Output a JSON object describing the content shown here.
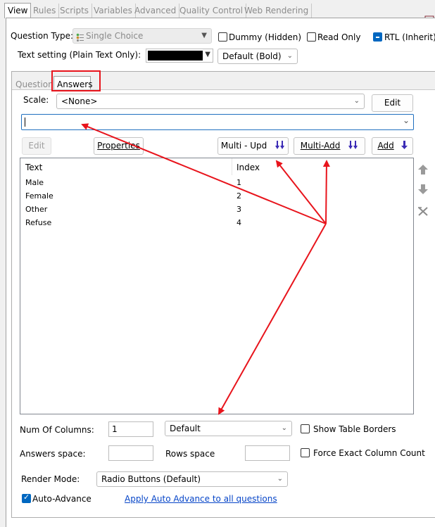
{
  "tabs": [
    "View",
    "Rules",
    "Scripts",
    "Variables",
    "Advanced",
    "Quality Control",
    "Web Rendering"
  ],
  "question_type": {
    "label": "Question Type:",
    "value": "Single Choice"
  },
  "options": {
    "dummy": "Dummy (Hidden)",
    "read_only": "Read Only",
    "rtl": "RTL (Inherit)"
  },
  "text_setting": {
    "label": "Text setting (Plain Text Only):",
    "style_value": "Default (Bold)"
  },
  "inner_tabs": [
    "Question",
    "Answers"
  ],
  "scale": {
    "label": "Scale:",
    "value": "<None>",
    "edit_button": "Edit"
  },
  "answer_input": {
    "value": ""
  },
  "buttons": {
    "edit": "Edit",
    "properties": "Properties",
    "multi_upd": "Multi - Upd",
    "multi_add": "Multi-Add",
    "add": "Add"
  },
  "answers_table": {
    "columns": [
      "Text",
      "Index"
    ],
    "rows": [
      {
        "text": "Male",
        "index": "1"
      },
      {
        "text": "Female",
        "index": "2"
      },
      {
        "text": "Other",
        "index": "3"
      },
      {
        "text": "Refuse",
        "index": "4"
      }
    ]
  },
  "layout_settings": {
    "num_columns_label": "Num Of Columns:",
    "num_columns_value": "1",
    "layout_value": "Default",
    "show_table_borders": "Show Table Borders",
    "answers_space_label": "Answers space:",
    "answers_space_value": "",
    "rows_space_label": "Rows space",
    "rows_space_value": "",
    "force_exact_column_count": "Force Exact Column Count",
    "render_mode_label": "Render Mode:",
    "render_mode_value": "Radio Buttons (Default)",
    "auto_advance": "Auto-Advance",
    "apply_auto_advance_link": "Apply Auto Advance to all questions"
  },
  "colors": {
    "annotation": "#e8141c",
    "accent": "#0067c0",
    "multi_icon": "#3b2bb5",
    "link": "#0645c8"
  }
}
